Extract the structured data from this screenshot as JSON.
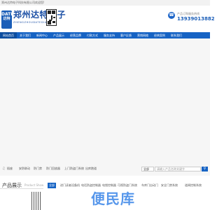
{
  "topbar": {
    "text": "郑州达特电子科技有限公司欢迎您!"
  },
  "header": {
    "logo_badge_line1": "DATE",
    "logo_badge_line2": "达特",
    "company_name": "郑州达特电子",
    "company_name_en": "ZHENGZHOUDATEDIANZI",
    "hotline_label": "产品订购服务热线",
    "hotline_number": "13939013882"
  },
  "nav": {
    "items": [
      {
        "label": "网站首页",
        "active": true
      },
      {
        "label": "关于我们"
      },
      {
        "label": "新闻中心"
      },
      {
        "label": "产品展示"
      },
      {
        "label": "经营品牌"
      },
      {
        "label": "付款方式"
      },
      {
        "label": "服务支持"
      },
      {
        "label": "客户反馈"
      },
      {
        "label": "营销网络"
      },
      {
        "label": "经典案例"
      },
      {
        "label": "联系我们"
      }
    ]
  },
  "categories": {
    "items": [
      "插座",
      "安防联动",
      "防门禁",
      "防门回放器",
      "上门防盗门系统",
      "出库跑道"
    ]
  },
  "search": {
    "select_value": "全部",
    "placeholder": "请输入产品名称关键字",
    "button_icon": "search-icon"
  },
  "products": {
    "title": "产品展示",
    "subtitle": "Product Show",
    "tabs": [
      "全部",
      "进门读者设备机",
      "电话防盗控制器",
      "电锁控制器",
      "可视防盗门系统",
      "车库门自动门",
      "安全门禁系统",
      "道闸控制系统"
    ]
  },
  "watermark": {
    "text": "便民库"
  },
  "colors": {
    "nav": "#1663c4",
    "nav_active": "#0d4e9f",
    "brand": "#1b5eb8",
    "watermark": "#3a86e8"
  }
}
